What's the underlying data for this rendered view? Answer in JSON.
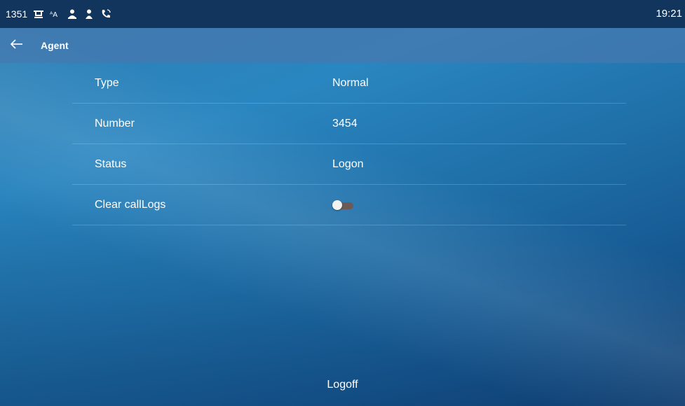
{
  "status_bar": {
    "extension": "1351",
    "time": "19:21",
    "icons": [
      "network-icon",
      "translate-icon",
      "contacts-icon",
      "user-icon",
      "call-forward-icon"
    ]
  },
  "header": {
    "back_icon": "back-arrow-icon",
    "title": "Agent"
  },
  "settings": {
    "type": {
      "label": "Type",
      "value": "Normal"
    },
    "number": {
      "label": "Number",
      "value": "3454"
    },
    "status": {
      "label": "Status",
      "value": "Logon"
    },
    "clear_call_logs": {
      "label": "Clear callLogs",
      "enabled": false
    }
  },
  "footer": {
    "logoff_label": "Logoff"
  },
  "colors": {
    "status_bar": "#12355e",
    "title_bar": "#4678af",
    "toggle_track_off": "#6b5a55",
    "toggle_knob": "#f2f2f2"
  }
}
